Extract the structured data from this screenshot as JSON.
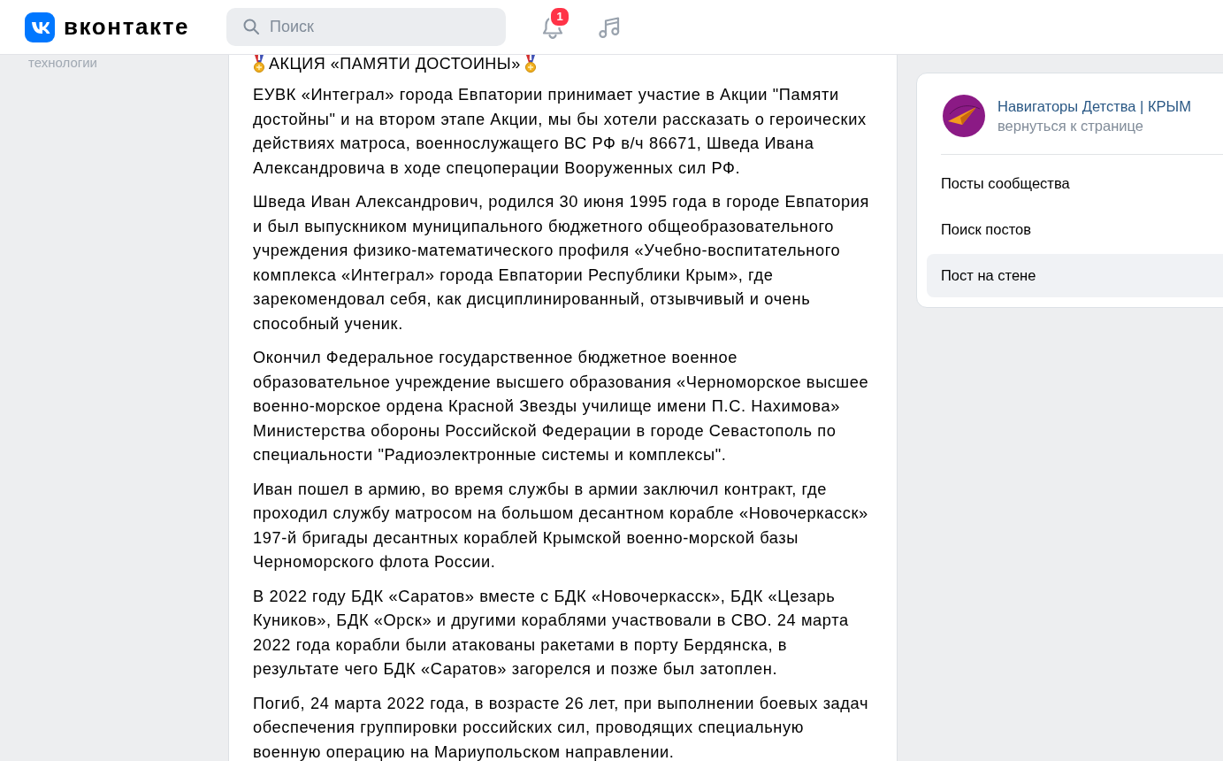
{
  "header": {
    "logo_text": "вконтакте",
    "search": {
      "placeholder": "Поиск"
    },
    "notifications": {
      "count": "1"
    }
  },
  "left_sidebar": {
    "items": [
      {
        "label": "технологии"
      }
    ]
  },
  "post": {
    "title": "АКЦИЯ «ПАМЯТИ ДОСТОИНЫ»",
    "paragraphs": [
      "ЕУВК «Интеграл» города Евпатории принимает участие в Акции \"Памяти достойны\" и на втором этапе Акции, мы бы хотели рассказать о героических действиях матроса, военнослужащего ВС РФ в/ч 86671, Шведа Ивана Александровича в ходе спецоперации Вооруженных сил РФ.",
      "Шведа Иван Александрович, родился 30 июня 1995 года в городе Евпатория и был выпускником муниципального бюджетного общеобразовательного учреждения физико-математического профиля «Учебно-воспитательного комплекса «Интеграл» города Евпатории Республики Крым», где зарекомендовал себя, как дисциплинированный, отзывчивый и очень способный ученик.",
      "Окончил Федеральное государственное бюджетное военное образовательное учреждение высшего образования «Черноморское высшее военно-морское ордена Красной Звезды училище имени П.С. Нахимова» Министерства обороны Российской Федерации в городе Севастополь по специальности \"Радиоэлектронные системы и комплексы\".",
      "Иван пошел в армию, во время службы в армии заключил контракт, где проходил службу матросом на большом десантном корабле «Новочеркасск» 197-й бригады десантных кораблей Крымской военно-морской базы Черноморского флота России.",
      "В 2022 году БДК «Саратов» вместе с БДК «Новочеркасск», БДК «Цезарь Куников», БДК «Орск» и другими кораблями участвовали в СВО. 24 марта 2022 года корабли были атакованы ракетами в порту Бердянска, в результате чего БДК «Саратов» загорелся и позже был затоплен.",
      "Погиб, 24 марта 2022 года, в возрасте 26 лет, при выполнении боевых задач обеспечения группировки российских сил, проводящих специальную военную операцию на Мариупольском направлении."
    ]
  },
  "side_panel": {
    "group": {
      "name": "Навигаторы Детства | КРЫМ",
      "link": "вернуться к странице"
    },
    "menu": [
      {
        "label": "Посты сообщества",
        "selected": false
      },
      {
        "label": "Поиск постов",
        "selected": false
      },
      {
        "label": "Пост на стене",
        "selected": true
      }
    ]
  }
}
